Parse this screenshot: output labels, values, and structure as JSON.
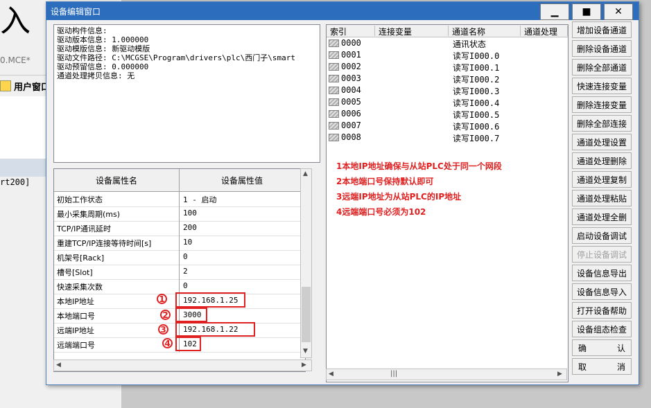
{
  "background": {
    "big_text": "入",
    "file_name": "0.MCE*",
    "tab_label": "用户窗口",
    "rt_text": "rt200]"
  },
  "window": {
    "title": "设备编辑窗口",
    "minimize": "▁",
    "maximize": "■",
    "close": "✕"
  },
  "info_lines": [
    "驱动构件信息:",
    "驱动版本信息: 1.000000",
    "驱动模版信息: 新驱动模版",
    "驱动文件路径: C:\\MCGSE\\Program\\drivers\\plc\\西门子\\smart",
    "驱动预留信息: 0.000000",
    "通道处理拷贝信息: 无"
  ],
  "property_grid": {
    "headers": [
      "设备属性名",
      "设备属性值"
    ],
    "rows": [
      {
        "name": "初始工作状态",
        "value": "1 - 启动"
      },
      {
        "name": "最小采集周期(ms)",
        "value": "100"
      },
      {
        "name": "TCP/IP通讯延时",
        "value": "200"
      },
      {
        "name": "重建TCP/IP连接等待时间[s]",
        "value": "10"
      },
      {
        "name": "机架号[Rack]",
        "value": "0"
      },
      {
        "name": "槽号[Slot]",
        "value": "2"
      },
      {
        "name": "快速采集次数",
        "value": "0"
      },
      {
        "name": "本地IP地址",
        "value": "192.168.1.25"
      },
      {
        "name": "本地端口号",
        "value": "3000"
      },
      {
        "name": "远端IP地址",
        "value": "192.168.1.22"
      },
      {
        "name": "远端端口号",
        "value": "102"
      }
    ],
    "markers": [
      "1",
      "2",
      "3",
      "4"
    ]
  },
  "channel_list": {
    "headers": [
      "索引",
      "连接变量",
      "通道名称",
      "通道处理"
    ],
    "rows": [
      {
        "index": "0000",
        "name": "通讯状态"
      },
      {
        "index": "0001",
        "name": "读写I000.0"
      },
      {
        "index": "0002",
        "name": "读写I000.1"
      },
      {
        "index": "0003",
        "name": "读写I000.2"
      },
      {
        "index": "0004",
        "name": "读写I000.3"
      },
      {
        "index": "0005",
        "name": "读写I000.4"
      },
      {
        "index": "0006",
        "name": "读写I000.5"
      },
      {
        "index": "0007",
        "name": "读写I000.6"
      },
      {
        "index": "0008",
        "name": "读写I000.7"
      }
    ]
  },
  "notes": [
    "1本地IP地址确保与从站PLC处于同一个网段",
    "2本地端口号保持默认即可",
    "3远端IP地址为从站PLC的IP地址",
    "4远端端口号必须为102"
  ],
  "buttons": [
    {
      "label": "增加设备通道",
      "enabled": true
    },
    {
      "label": "删除设备通道",
      "enabled": true
    },
    {
      "label": "删除全部通道",
      "enabled": true
    },
    {
      "label": "快速连接变量",
      "enabled": true
    },
    {
      "label": "删除连接变量",
      "enabled": true
    },
    {
      "label": "删除全部连接",
      "enabled": true
    },
    {
      "label": "通道处理设置",
      "enabled": true
    },
    {
      "label": "通道处理删除",
      "enabled": true
    },
    {
      "label": "通道处理复制",
      "enabled": true
    },
    {
      "label": "通道处理粘贴",
      "enabled": true
    },
    {
      "label": "通道处理全删",
      "enabled": true
    },
    {
      "label": "启动设备调试",
      "enabled": true
    },
    {
      "label": "停止设备调试",
      "enabled": false
    },
    {
      "label": "设备信息导出",
      "enabled": true
    },
    {
      "label": "设备信息导入",
      "enabled": true
    },
    {
      "label": "打开设备帮助",
      "enabled": true
    },
    {
      "label": "设备组态检查",
      "enabled": true
    }
  ],
  "confirm": {
    "left": "确",
    "right": "认"
  },
  "cancel": {
    "left": "取",
    "right": "消"
  },
  "colors": {
    "annotation": "#e02020",
    "titlebar": "#2c6ebd"
  }
}
